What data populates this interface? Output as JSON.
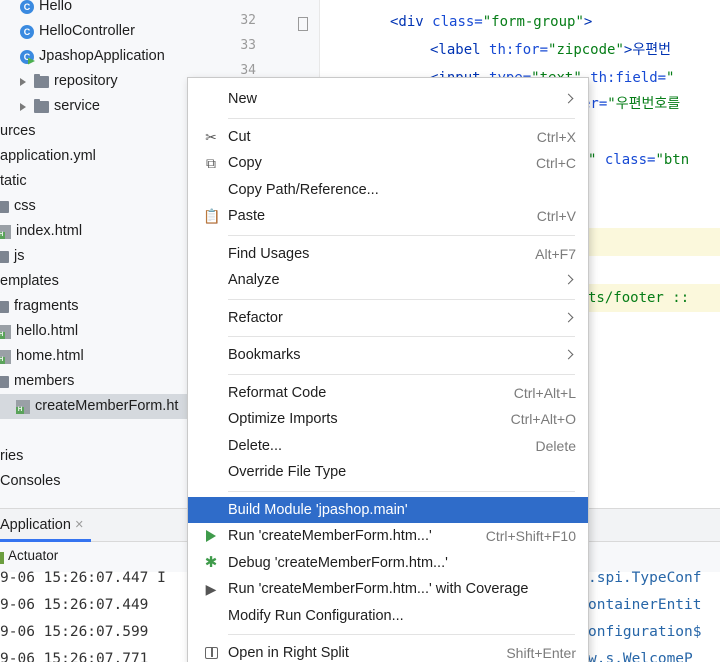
{
  "tree": [
    {
      "label": "Hello",
      "icon": "class-icon",
      "kind": "class"
    },
    {
      "label": "HelloController",
      "icon": "class-icon",
      "kind": "class"
    },
    {
      "label": "JpashopApplication",
      "icon": "spring-application-class-icon",
      "kind": "app"
    },
    {
      "label": "repository",
      "icon": "folder-icon",
      "kind": "folder",
      "arrow": true
    },
    {
      "label": "service",
      "icon": "folder-icon",
      "kind": "folder",
      "arrow": true
    },
    {
      "label": "urces",
      "icon": "",
      "kind": "text"
    },
    {
      "label": "application.yml",
      "icon": "",
      "kind": "text"
    },
    {
      "label": "tatic",
      "icon": "",
      "kind": "text"
    },
    {
      "label": "css",
      "icon": "folder-icon",
      "kind": "folder"
    },
    {
      "label": "index.html",
      "icon": "html-file-icon",
      "kind": "html"
    },
    {
      "label": "js",
      "icon": "folder-icon",
      "kind": "folder"
    },
    {
      "label": "emplates",
      "icon": "",
      "kind": "text"
    },
    {
      "label": "fragments",
      "icon": "folder-icon",
      "kind": "folder"
    },
    {
      "label": "hello.html",
      "icon": "html-file-icon",
      "kind": "html"
    },
    {
      "label": "home.html",
      "icon": "html-file-icon",
      "kind": "html"
    },
    {
      "label": "members",
      "icon": "folder-icon",
      "kind": "folder"
    },
    {
      "label": "createMemberForm.ht",
      "icon": "html-file-icon",
      "kind": "html",
      "selected": true
    },
    {
      "label": "",
      "icon": "",
      "kind": "text"
    },
    {
      "label": "ries",
      "icon": "",
      "kind": "text"
    },
    {
      "label": "Consoles",
      "icon": "",
      "kind": "text"
    }
  ],
  "editor": {
    "line_numbers": [
      "32",
      "33",
      "34"
    ],
    "lines": [
      {
        "parts": [
          {
            "t": "<div ",
            "c": "tag"
          },
          {
            "t": "class=",
            "c": "attr"
          },
          {
            "t": "\"form-group\"",
            "c": "str"
          },
          {
            "t": ">",
            "c": "tag"
          }
        ]
      },
      {
        "parts": [
          {
            "t": "<label ",
            "c": "tag"
          },
          {
            "t": "th:for=",
            "c": "attr"
          },
          {
            "t": "\"zipcode\"",
            "c": "str"
          },
          {
            "t": ">우편번",
            "c": "tag"
          }
        ]
      },
      {
        "parts": [
          {
            "t": "<input ",
            "c": "tag"
          },
          {
            "t": "type=",
            "c": "attr"
          },
          {
            "t": "\"text\" ",
            "c": "str"
          },
          {
            "t": "th:field=",
            "c": "attr"
          },
          {
            "t": "\"",
            "c": "str"
          }
        ]
      },
      {
        "parts": [
          {
            "t": "er=",
            "c": "attr"
          },
          {
            "t": "\"우편번호를",
            "c": "str"
          }
        ]
      },
      {
        "parts": [
          {
            "t": "\" ",
            "c": "str"
          },
          {
            "t": "class=",
            "c": "attr"
          },
          {
            "t": "\"btn",
            "c": "str"
          }
        ]
      },
      {
        "parts": [
          {
            "t": "ts/footer ::",
            "c": "str"
          }
        ]
      }
    ]
  },
  "run_panel": {
    "tab_label": "Application",
    "close_glyph": "×",
    "actuator_label": "Actuator",
    "logs": [
      {
        "left": "9-06 15:26:07.447 I",
        "right": ".spi.TypeConf"
      },
      {
        "left": "9-06 15:26:07.449",
        "right": "ontainerEntit"
      },
      {
        "left": "9-06 15:26:07.599",
        "right": "onfiguration$"
      },
      {
        "left": "9-06 15:26:07.771",
        "right": "w.s.WelcomeP"
      }
    ]
  },
  "menu": {
    "items": [
      {
        "label": "New",
        "shortcut": "",
        "submenu": true,
        "icon": "",
        "name": "new"
      },
      {
        "sep": true
      },
      {
        "label": "Cut",
        "shortcut": "Ctrl+X",
        "icon": "scissors-icon",
        "glyph": "✂",
        "name": "cut"
      },
      {
        "label": "Copy",
        "shortcut": "Ctrl+C",
        "icon": "copy-icon",
        "glyph": "⧉",
        "name": "copy"
      },
      {
        "label": "Copy Path/Reference...",
        "shortcut": "",
        "icon": "",
        "name": "copy-path"
      },
      {
        "label": "Paste",
        "shortcut": "Ctrl+V",
        "icon": "clipboard-icon",
        "glyph": "📋",
        "name": "paste"
      },
      {
        "sep": true
      },
      {
        "label": "Find Usages",
        "shortcut": "Alt+F7",
        "icon": "",
        "name": "find-usages"
      },
      {
        "label": "Analyze",
        "shortcut": "",
        "submenu": true,
        "icon": "",
        "name": "analyze"
      },
      {
        "sep": true
      },
      {
        "label": "Refactor",
        "shortcut": "",
        "submenu": true,
        "icon": "",
        "name": "refactor"
      },
      {
        "sep": true
      },
      {
        "label": "Bookmarks",
        "shortcut": "",
        "submenu": true,
        "icon": "",
        "name": "bookmarks"
      },
      {
        "sep": true
      },
      {
        "label": "Reformat Code",
        "shortcut": "Ctrl+Alt+L",
        "icon": "",
        "name": "reformat-code"
      },
      {
        "label": "Optimize Imports",
        "shortcut": "Ctrl+Alt+O",
        "icon": "",
        "name": "optimize-imports"
      },
      {
        "label": "Delete...",
        "shortcut": "Delete",
        "icon": "",
        "name": "delete"
      },
      {
        "label": "Override File Type",
        "shortcut": "",
        "icon": "",
        "name": "override-file-type"
      },
      {
        "sep": true
      },
      {
        "label": "Build Module 'jpashop.main'",
        "shortcut": "",
        "icon": "",
        "active": true,
        "name": "build-module"
      },
      {
        "label": "Run 'createMemberForm.htm...'",
        "shortcut": "Ctrl+Shift+F10",
        "icon": "run-icon",
        "name": "run"
      },
      {
        "label": "Debug 'createMemberForm.htm...'",
        "shortcut": "",
        "icon": "debug-icon",
        "glyph": "✱",
        "name": "debug"
      },
      {
        "label": "Run 'createMemberForm.htm...' with Coverage",
        "shortcut": "",
        "icon": "coverage-icon",
        "glyph": "▶",
        "name": "run-with-coverage"
      },
      {
        "label": "Modify Run Configuration...",
        "shortcut": "",
        "icon": "",
        "name": "modify-run-configuration"
      },
      {
        "sep": true
      },
      {
        "label": "Open in Right Split",
        "shortcut": "Shift+Enter",
        "icon": "split-icon",
        "name": "open-in-right-split"
      }
    ]
  }
}
